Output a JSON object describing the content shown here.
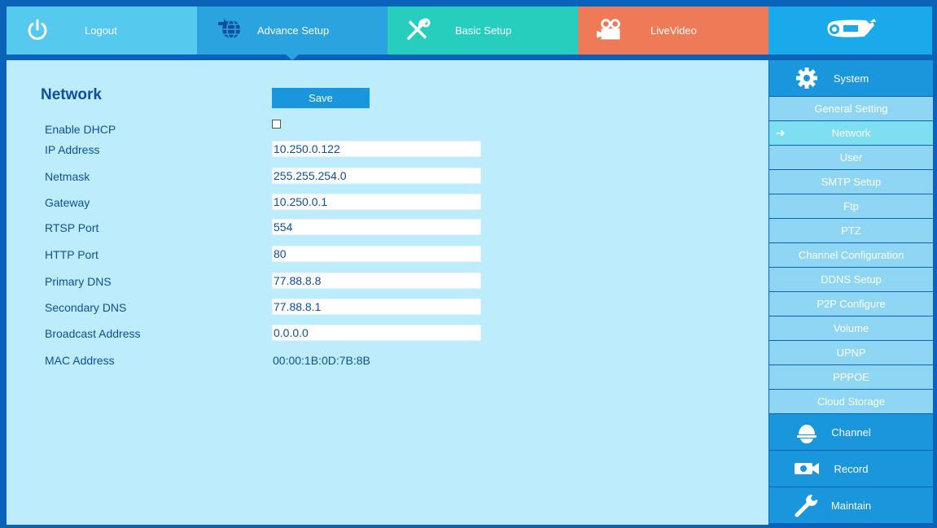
{
  "topbar": {
    "tabs": [
      {
        "label": "Logout",
        "icon": "power-icon"
      },
      {
        "label": "Advance Setup",
        "icon": "globe-gear-icon"
      },
      {
        "label": "Basic Setup",
        "icon": "tools-icon"
      },
      {
        "label": "LiveVideo",
        "icon": "video-camera-icon"
      }
    ],
    "logo_icon": "bullet-camera-icon"
  },
  "main": {
    "title": "Network",
    "save_label": "Save",
    "fields": {
      "dhcp": {
        "label": "Enable DHCP",
        "checked": false
      },
      "ip": {
        "label": "IP Address",
        "value": "10.250.0.122"
      },
      "netmask": {
        "label": "Netmask",
        "value": "255.255.254.0"
      },
      "gateway": {
        "label": "Gateway",
        "value": "10.250.0.1"
      },
      "rtsp": {
        "label": "RTSP Port",
        "value": "554"
      },
      "http": {
        "label": "HTTP Port",
        "value": "80"
      },
      "dns1": {
        "label": "Primary DNS",
        "value": "77.88.8.8"
      },
      "dns2": {
        "label": "Secondary DNS",
        "value": "77.88.8.1"
      },
      "broadcast": {
        "label": "Broadcast Address",
        "value": "0.0.0.0"
      },
      "mac": {
        "label": "MAC Address",
        "value": "00:00:1B:0D:7B:8B"
      }
    }
  },
  "sidebar": {
    "system": {
      "label": "System",
      "icon": "gear-icon"
    },
    "items": [
      "General Setting",
      "Network",
      "User",
      "SMTP Setup",
      "Ftp",
      "PTZ",
      "Channel Configuration",
      "DDNS Setup",
      "P2P Configure",
      "Volume",
      "UPNP",
      "PPPOE",
      "Cloud Storage"
    ],
    "active_item": "Network",
    "sections": [
      {
        "label": "Channel",
        "icon": "dome-camera-icon"
      },
      {
        "label": "Record",
        "icon": "record-camera-icon"
      },
      {
        "label": "Maintain",
        "icon": "wrench-icon"
      }
    ]
  },
  "colors": {
    "frame": "#0a63b8",
    "panel": "#bdedfc",
    "text": "#0d4f9e",
    "tab_logout": "#55c9ee",
    "tab_advance": "#2aa3de",
    "tab_basic": "#27cdbd",
    "tab_live": "#ef7a58",
    "sidebar_section": "#1a96dc",
    "sidebar_item": "#8ed6f3"
  }
}
